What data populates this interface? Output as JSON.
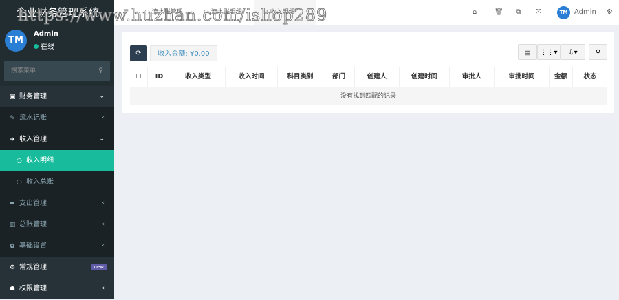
{
  "app": {
    "title": "企业财务管理系统",
    "watermark": "https://www.huzhan.com/ishop289"
  },
  "user": {
    "name": "Admin",
    "status": "在线",
    "avatar": "TM"
  },
  "search": {
    "placeholder": "搜索菜单"
  },
  "menu": [
    {
      "label": "财务管理",
      "icon": "money-icon"
    },
    {
      "label": "流水记账",
      "icon": "edit-icon"
    },
    {
      "label": "收入管理",
      "icon": "sign-in-icon"
    },
    {
      "label": "收入明细",
      "icon": "circle-icon"
    },
    {
      "label": "收入总账",
      "icon": "circle-icon"
    },
    {
      "label": "支出管理",
      "icon": "sign-out-icon"
    },
    {
      "label": "总账管理",
      "icon": "bar-chart-icon"
    },
    {
      "label": "基础设置",
      "icon": "gear-icon"
    },
    {
      "label": "常规管理",
      "icon": "cogs-icon",
      "badge": "new"
    },
    {
      "label": "权限管理",
      "icon": "group-icon"
    }
  ],
  "tabs": [
    {
      "label": "流水账管理"
    },
    {
      "label": "流水账明细"
    },
    {
      "label": "收入明细"
    }
  ],
  "header": {
    "user": "Admin"
  },
  "toolbar": {
    "amount_label": "收入金额: ¥0.00"
  },
  "table": {
    "columns": [
      "ID",
      "收入类型",
      "收入时间",
      "科目类别",
      "部门",
      "创建人",
      "创建时间",
      "审批人",
      "审批时间",
      "金额",
      "状态"
    ],
    "empty": "没有找到匹配的记录"
  },
  "colors": {
    "accent": "#18bc9c",
    "sidebar": "#222d32",
    "primary": "#2c3e50"
  }
}
